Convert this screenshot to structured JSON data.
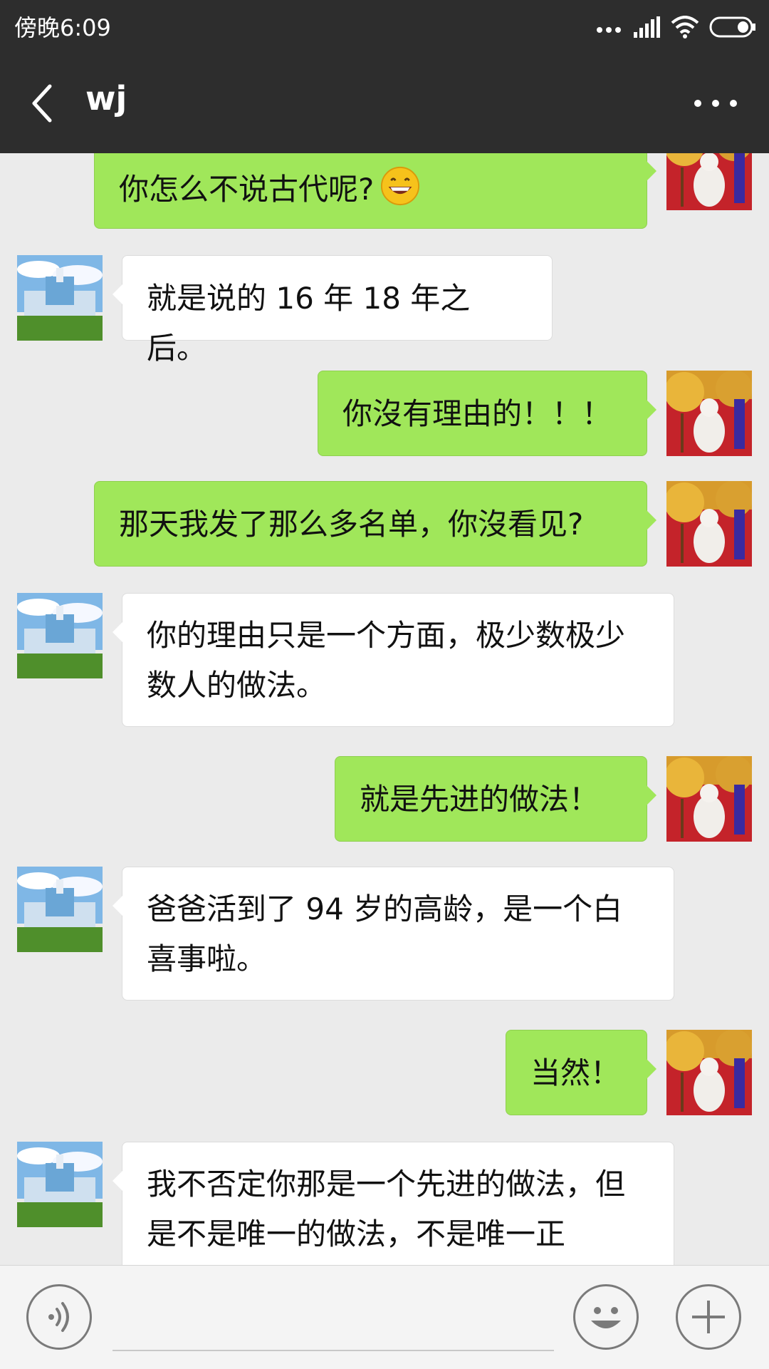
{
  "status_bar": {
    "time": "傍晚6:09",
    "icons": [
      "more-dots-icon",
      "signal-icon",
      "wifi-icon",
      "battery-icon"
    ]
  },
  "header": {
    "title": "wj",
    "back_icon": "back-arrow-icon",
    "more_icon": "more-icon"
  },
  "colors": {
    "my_bubble": "#a0e75a",
    "other_bubble": "#ffffff",
    "chat_background": "#ebebeb",
    "header_background": "#2d2d2d"
  },
  "messages": [
    {
      "sender": "me",
      "text": "你怎么不说古代呢?",
      "emoji": "grinning-face-icon"
    },
    {
      "sender": "other",
      "text": "就是说的 16 年 18 年之后。"
    },
    {
      "sender": "me",
      "text": "你沒有理由的！！！"
    },
    {
      "sender": "me",
      "text": "那天我发了那么多名单，你沒看见?"
    },
    {
      "sender": "other",
      "text": "你的理由只是一个方面，极少数极少数人的做法。"
    },
    {
      "sender": "me",
      "text": "就是先进的做法！"
    },
    {
      "sender": "other",
      "text": "爸爸活到了 94 岁的高龄，是一个白喜事啦。"
    },
    {
      "sender": "me",
      "text": "当然！"
    },
    {
      "sender": "other",
      "text": "我不否定你那是一个先进的做法，但是不是唯一的做法，不是唯一正"
    }
  ],
  "input_bar": {
    "voice_icon": "voice-icon",
    "emoji_icon": "emoji-icon",
    "plus_icon": "plus-icon"
  }
}
